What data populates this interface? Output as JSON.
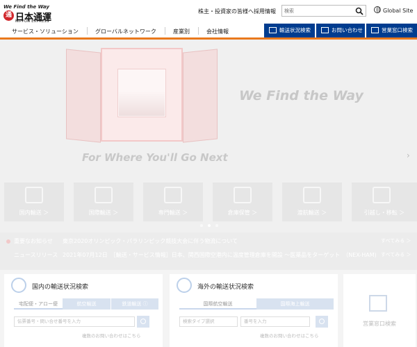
{
  "logo": {
    "tagline": "We Find the Way",
    "seal": "通",
    "name_jp": "日本通運",
    "name_en": "NIPPON EXPRESS"
  },
  "topbar": {
    "links": [
      "株主・投資家の皆様へ",
      "採用情報"
    ],
    "search_placeholder": "検索",
    "global_label": "Global Site"
  },
  "nav": {
    "items": [
      "サービス・ソリューション",
      "グローバルネットワーク",
      "産業別",
      "会社情報"
    ],
    "buttons": [
      "輸送状況検索",
      "お問い合わせ",
      "営業窓口検索"
    ]
  },
  "hero": {
    "headline": "We Find the Way",
    "subline": "For Where You'll Go Next",
    "cards": [
      "国内輸送 ＞",
      "国際輸送 ＞",
      "専門輸送 ＞",
      "倉庫保管 ＞",
      "渡航輸送 ＞",
      "引越し・移転 ＞"
    ]
  },
  "news": {
    "important_label": "重要なお知らせ",
    "important_text": "東京2020オリンピック・パラリンピック競技大会に伴う物流について",
    "important_more": "すべてみる ＞",
    "release_label": "ニュースリリース",
    "release_text": "2021年07月12日　［輸送・サービス情報］日本、関西国際空港内に温度管理倉庫を開設 ～医薬品をターゲット　（NEX-HAM)",
    "release_more": "すべてみる ＞"
  },
  "panels": {
    "domestic": {
      "title": "国内の輸送状況検索",
      "tabs": [
        "宅配便・アロー便",
        "航空輸送",
        "鉄道輸送 ⓘ"
      ],
      "input_placeholder": "伝票番号・問い合せ番号を入力",
      "link": "複数のお問い合わせはこちら"
    },
    "overseas": {
      "title": "海外の輸送状況検索",
      "tabs": [
        "国際航空輸送",
        "国際海上輸送"
      ],
      "select_placeholder": "検索タイプ選択",
      "input_placeholder": "番号を入力",
      "link": "複数のお問い合わせはこちら"
    },
    "office": {
      "label": "営業窓口検索"
    }
  }
}
